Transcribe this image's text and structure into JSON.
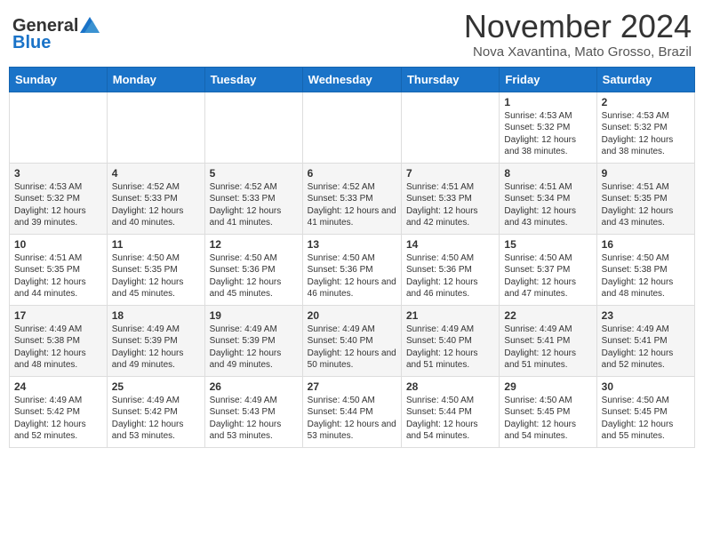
{
  "header": {
    "logo_general": "General",
    "logo_blue": "Blue",
    "month": "November 2024",
    "location": "Nova Xavantina, Mato Grosso, Brazil"
  },
  "weekdays": [
    "Sunday",
    "Monday",
    "Tuesday",
    "Wednesday",
    "Thursday",
    "Friday",
    "Saturday"
  ],
  "weeks": [
    [
      {
        "day": "",
        "info": ""
      },
      {
        "day": "",
        "info": ""
      },
      {
        "day": "",
        "info": ""
      },
      {
        "day": "",
        "info": ""
      },
      {
        "day": "",
        "info": ""
      },
      {
        "day": "1",
        "info": "Sunrise: 4:53 AM\nSunset: 5:32 PM\nDaylight: 12 hours and 38 minutes."
      },
      {
        "day": "2",
        "info": "Sunrise: 4:53 AM\nSunset: 5:32 PM\nDaylight: 12 hours and 38 minutes."
      }
    ],
    [
      {
        "day": "3",
        "info": "Sunrise: 4:53 AM\nSunset: 5:32 PM\nDaylight: 12 hours and 39 minutes."
      },
      {
        "day": "4",
        "info": "Sunrise: 4:52 AM\nSunset: 5:33 PM\nDaylight: 12 hours and 40 minutes."
      },
      {
        "day": "5",
        "info": "Sunrise: 4:52 AM\nSunset: 5:33 PM\nDaylight: 12 hours and 41 minutes."
      },
      {
        "day": "6",
        "info": "Sunrise: 4:52 AM\nSunset: 5:33 PM\nDaylight: 12 hours and 41 minutes."
      },
      {
        "day": "7",
        "info": "Sunrise: 4:51 AM\nSunset: 5:33 PM\nDaylight: 12 hours and 42 minutes."
      },
      {
        "day": "8",
        "info": "Sunrise: 4:51 AM\nSunset: 5:34 PM\nDaylight: 12 hours and 43 minutes."
      },
      {
        "day": "9",
        "info": "Sunrise: 4:51 AM\nSunset: 5:35 PM\nDaylight: 12 hours and 43 minutes."
      }
    ],
    [
      {
        "day": "10",
        "info": "Sunrise: 4:51 AM\nSunset: 5:35 PM\nDaylight: 12 hours and 44 minutes."
      },
      {
        "day": "11",
        "info": "Sunrise: 4:50 AM\nSunset: 5:35 PM\nDaylight: 12 hours and 45 minutes."
      },
      {
        "day": "12",
        "info": "Sunrise: 4:50 AM\nSunset: 5:36 PM\nDaylight: 12 hours and 45 minutes."
      },
      {
        "day": "13",
        "info": "Sunrise: 4:50 AM\nSunset: 5:36 PM\nDaylight: 12 hours and 46 minutes."
      },
      {
        "day": "14",
        "info": "Sunrise: 4:50 AM\nSunset: 5:36 PM\nDaylight: 12 hours and 46 minutes."
      },
      {
        "day": "15",
        "info": "Sunrise: 4:50 AM\nSunset: 5:37 PM\nDaylight: 12 hours and 47 minutes."
      },
      {
        "day": "16",
        "info": "Sunrise: 4:50 AM\nSunset: 5:38 PM\nDaylight: 12 hours and 48 minutes."
      }
    ],
    [
      {
        "day": "17",
        "info": "Sunrise: 4:49 AM\nSunset: 5:38 PM\nDaylight: 12 hours and 48 minutes."
      },
      {
        "day": "18",
        "info": "Sunrise: 4:49 AM\nSunset: 5:39 PM\nDaylight: 12 hours and 49 minutes."
      },
      {
        "day": "19",
        "info": "Sunrise: 4:49 AM\nSunset: 5:39 PM\nDaylight: 12 hours and 49 minutes."
      },
      {
        "day": "20",
        "info": "Sunrise: 4:49 AM\nSunset: 5:40 PM\nDaylight: 12 hours and 50 minutes."
      },
      {
        "day": "21",
        "info": "Sunrise: 4:49 AM\nSunset: 5:40 PM\nDaylight: 12 hours and 51 minutes."
      },
      {
        "day": "22",
        "info": "Sunrise: 4:49 AM\nSunset: 5:41 PM\nDaylight: 12 hours and 51 minutes."
      },
      {
        "day": "23",
        "info": "Sunrise: 4:49 AM\nSunset: 5:41 PM\nDaylight: 12 hours and 52 minutes."
      }
    ],
    [
      {
        "day": "24",
        "info": "Sunrise: 4:49 AM\nSunset: 5:42 PM\nDaylight: 12 hours and 52 minutes."
      },
      {
        "day": "25",
        "info": "Sunrise: 4:49 AM\nSunset: 5:42 PM\nDaylight: 12 hours and 53 minutes."
      },
      {
        "day": "26",
        "info": "Sunrise: 4:49 AM\nSunset: 5:43 PM\nDaylight: 12 hours and 53 minutes."
      },
      {
        "day": "27",
        "info": "Sunrise: 4:50 AM\nSunset: 5:44 PM\nDaylight: 12 hours and 53 minutes."
      },
      {
        "day": "28",
        "info": "Sunrise: 4:50 AM\nSunset: 5:44 PM\nDaylight: 12 hours and 54 minutes."
      },
      {
        "day": "29",
        "info": "Sunrise: 4:50 AM\nSunset: 5:45 PM\nDaylight: 12 hours and 54 minutes."
      },
      {
        "day": "30",
        "info": "Sunrise: 4:50 AM\nSunset: 5:45 PM\nDaylight: 12 hours and 55 minutes."
      }
    ]
  ]
}
